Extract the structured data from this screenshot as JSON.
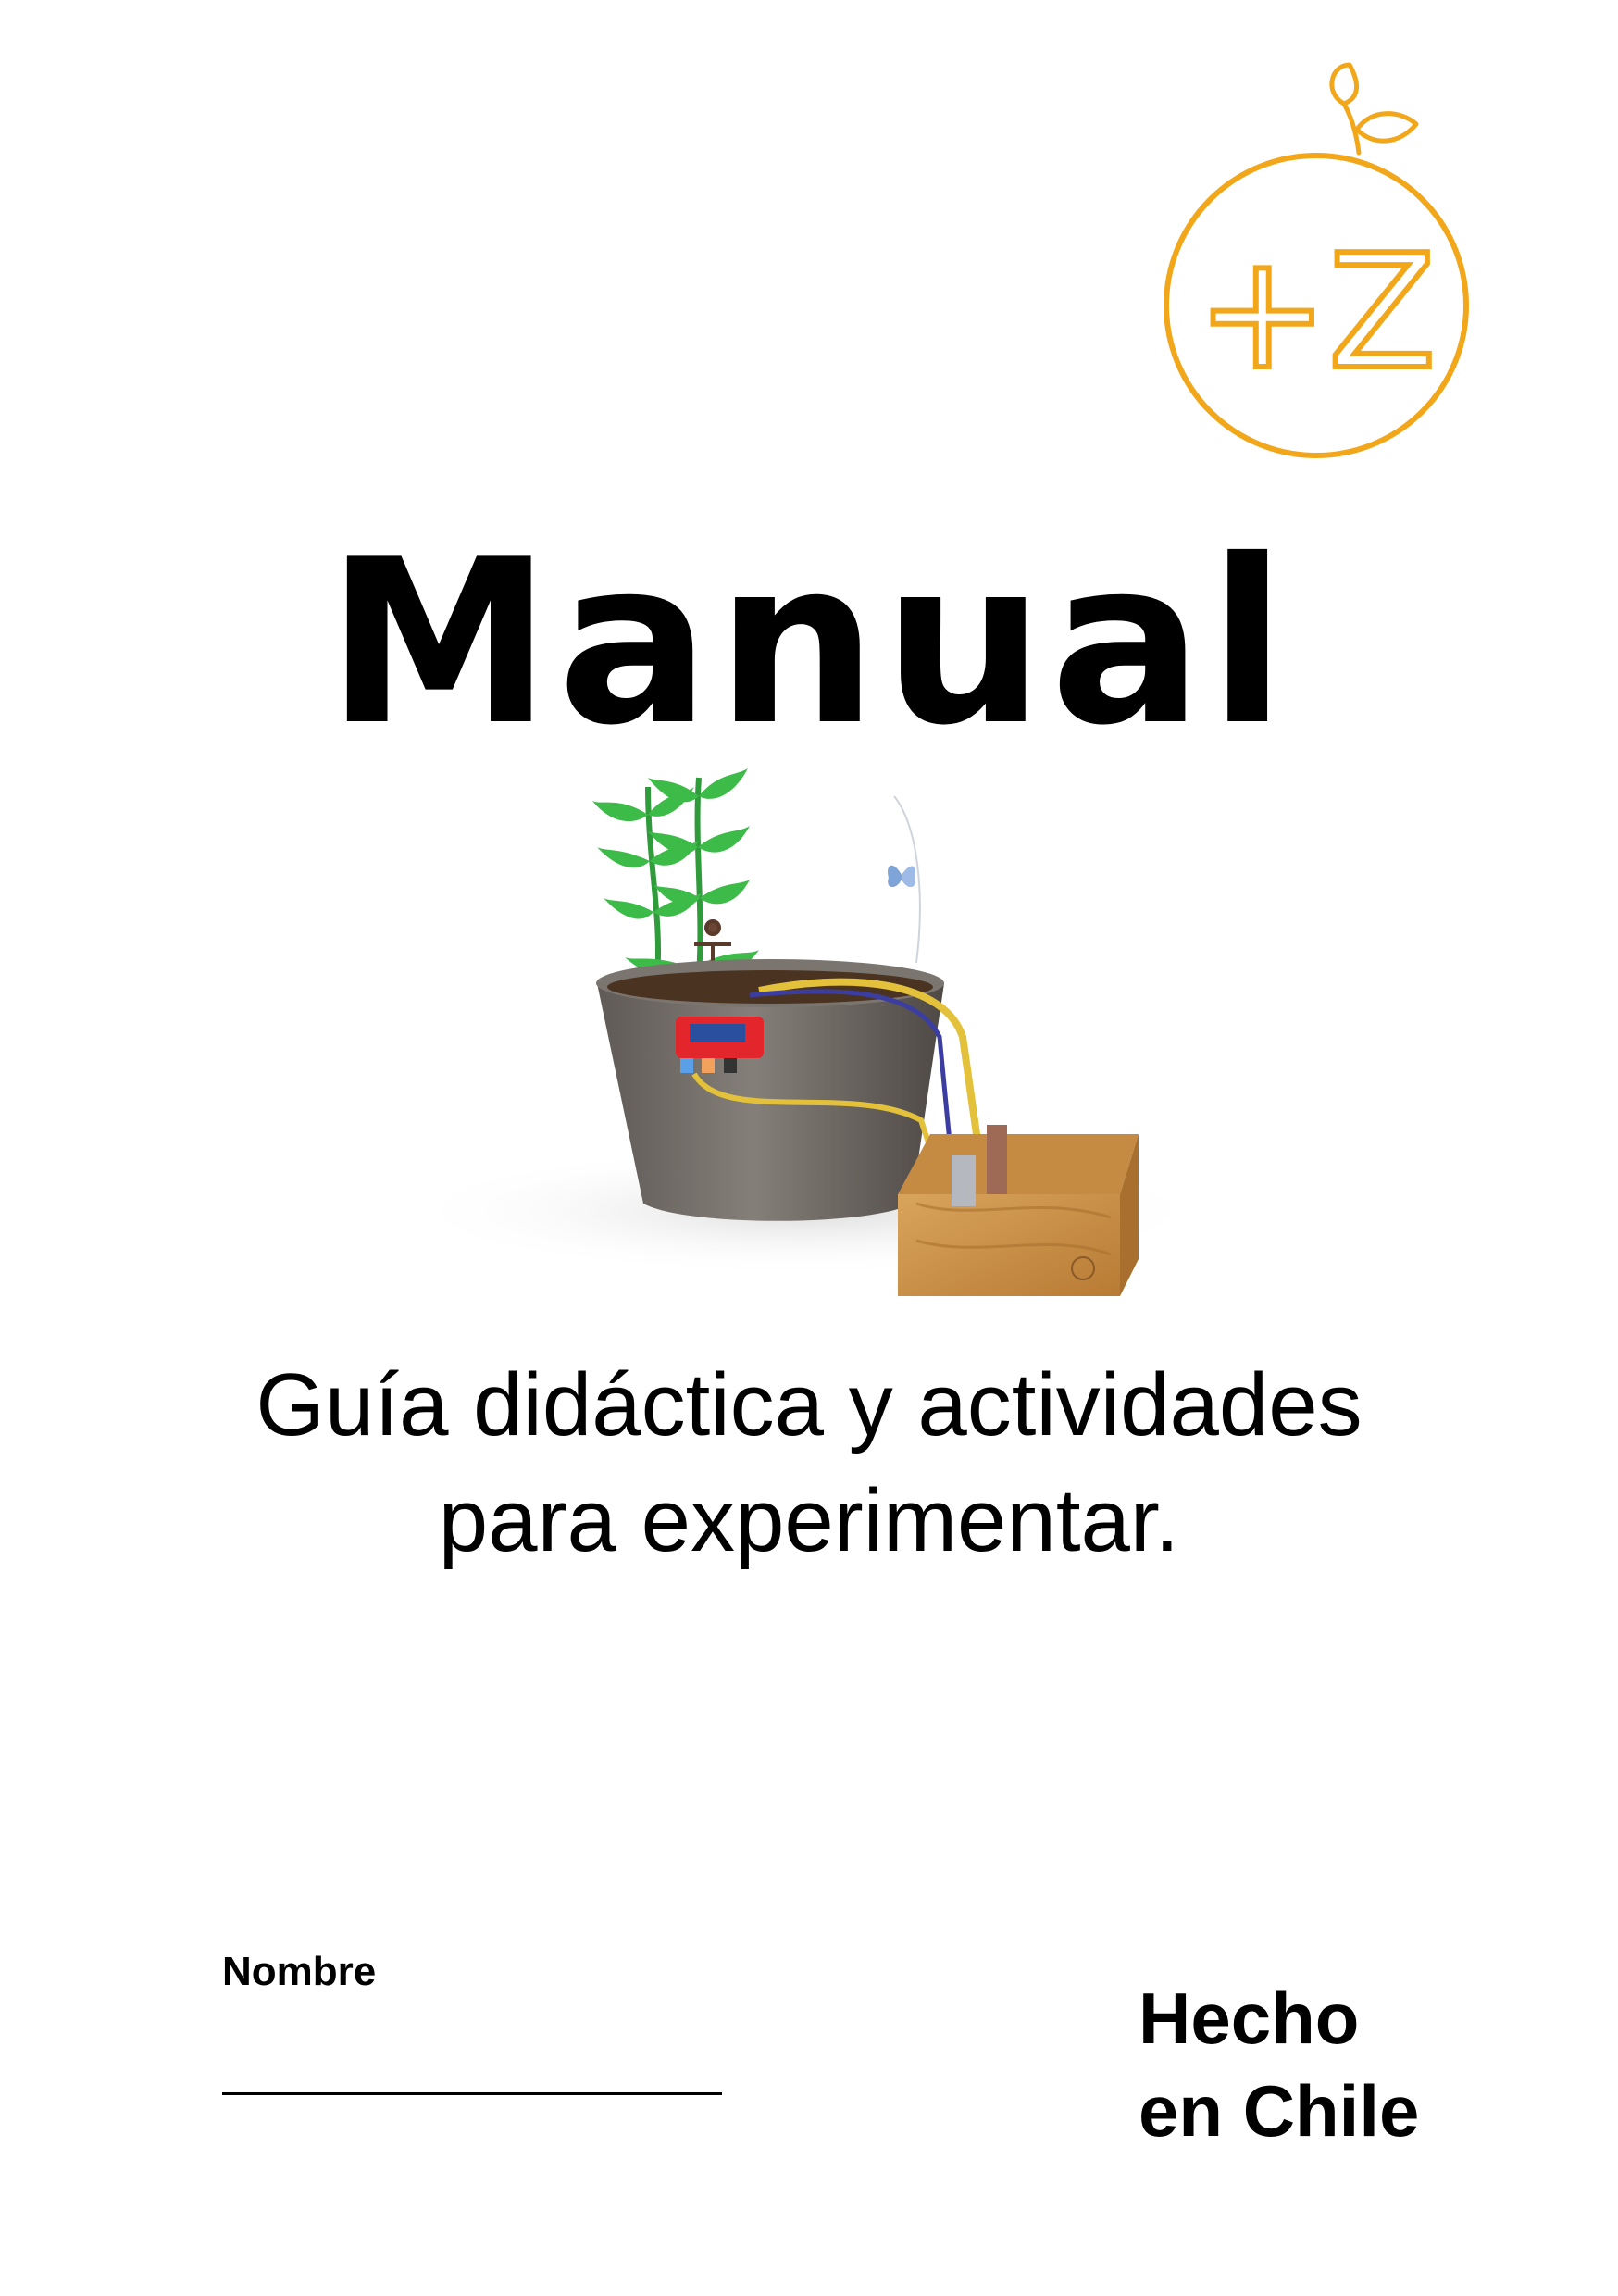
{
  "logo": {
    "text": "+Z",
    "accent_color": "#F2A71B",
    "icon": "sprout-orange-logo"
  },
  "title": "Manual",
  "illustration": {
    "icon": "plant-pot-water-tank-illustration"
  },
  "subtitle": {
    "line1": "Guía didáctica y actividades",
    "line2": "para experimentar."
  },
  "name_field": {
    "label": "Nombre"
  },
  "made_in": {
    "line1": "Hecho",
    "line2": "en Chile"
  }
}
